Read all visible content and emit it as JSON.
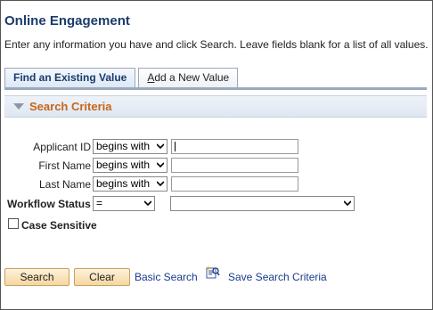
{
  "page": {
    "title": "Online Engagement",
    "instructions": "Enter any information you have and click Search. Leave fields blank for a list of all values."
  },
  "tabs": [
    {
      "label": "Find an Existing Value",
      "active": true
    },
    {
      "label_first": "A",
      "label_rest": "dd a New Value",
      "active": false
    }
  ],
  "section": {
    "title": "Search Criteria"
  },
  "fields": {
    "applicant_id": {
      "label": "Applicant ID",
      "operator": "begins with",
      "value": ""
    },
    "first_name": {
      "label": "First Name",
      "operator": "begins with",
      "value": ""
    },
    "last_name": {
      "label": "Last Name",
      "operator": "begins with",
      "value": ""
    },
    "workflow_status": {
      "label": "Workflow Status",
      "operator": "=",
      "value": ""
    }
  },
  "case_sensitive": {
    "label": "Case Sensitive",
    "checked": false
  },
  "buttons": {
    "search": "Search",
    "clear": "Clear",
    "basic_search": "Basic Search",
    "save_search": "Save Search Criteria"
  },
  "colors": {
    "title": "#1a3b6b",
    "section_title": "#c6661a",
    "link": "#1a3b8b",
    "button_bg": "#f5d79f"
  }
}
